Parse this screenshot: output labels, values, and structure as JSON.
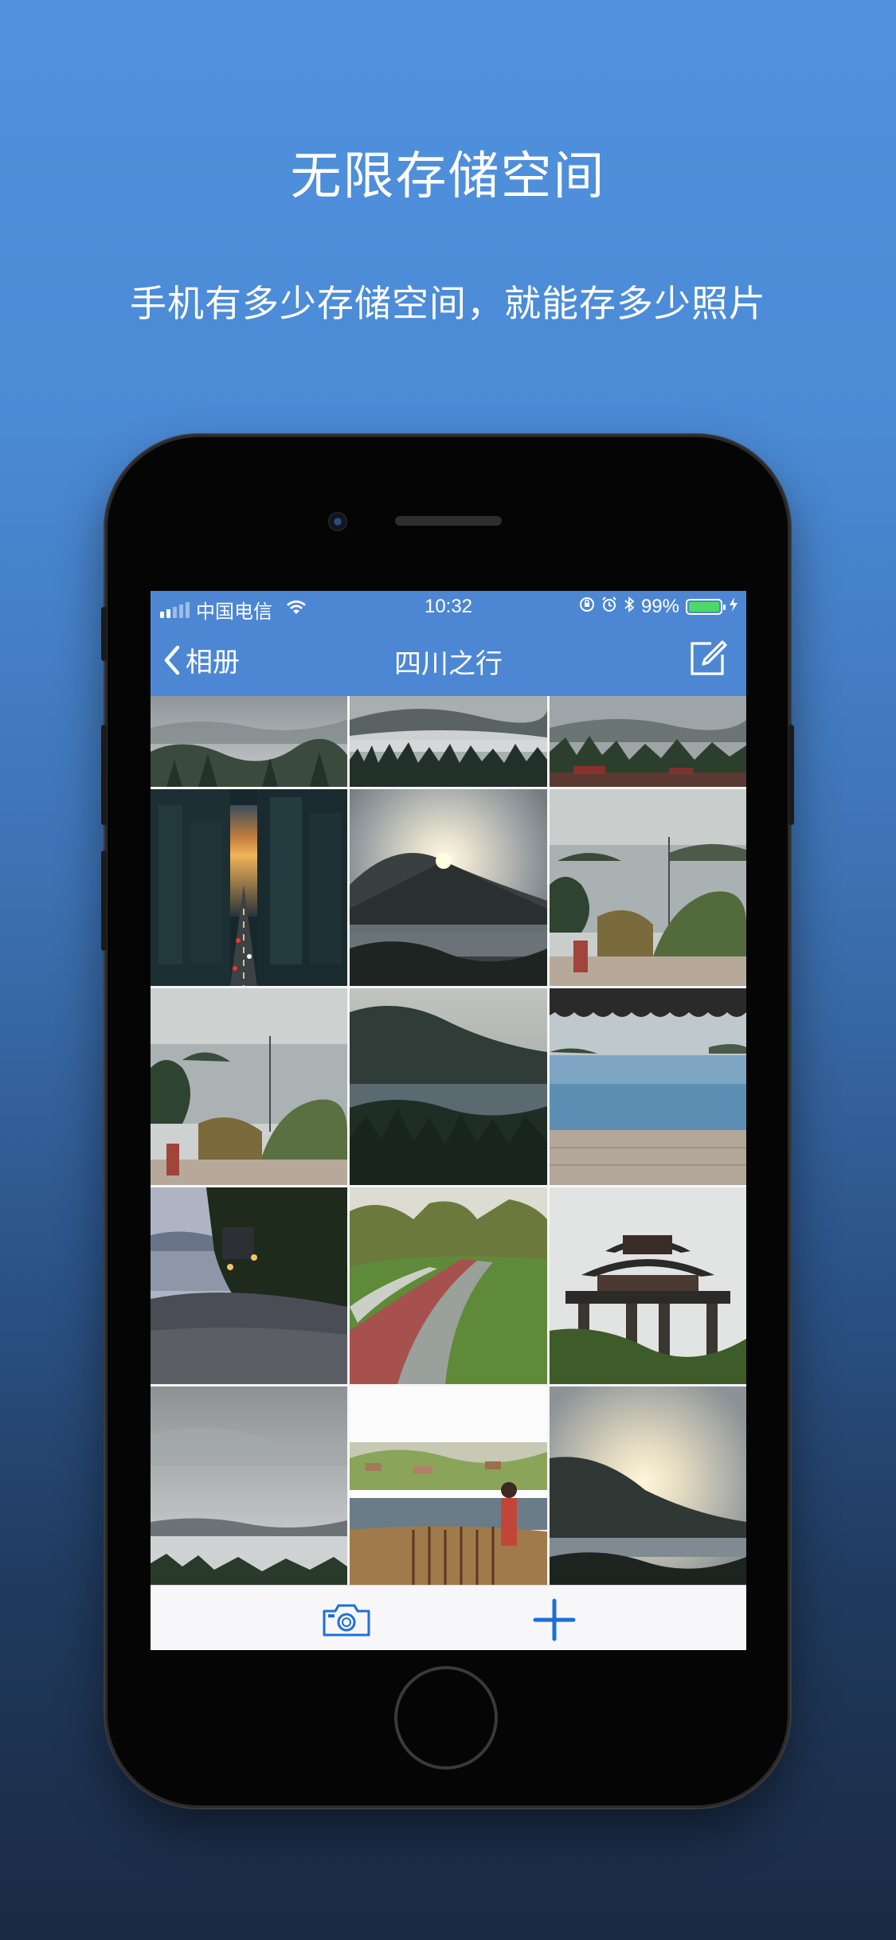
{
  "promo": {
    "title": "无限存储空间",
    "subtitle": "手机有多少存储空间，就能存多少照片"
  },
  "status_bar": {
    "carrier": "中国电信",
    "time": "10:32",
    "battery_percent": "99%",
    "battery_level": 0.99
  },
  "nav": {
    "back_label": "相册",
    "title": "四川之行"
  },
  "toolbar": {
    "camera_icon": "camera-icon",
    "add_icon": "plus-icon"
  },
  "colors": {
    "accent": "#1e6fd9",
    "nav_bar": "#4d87d3",
    "battery_fill": "#4cd964"
  },
  "photos": [
    "misty-lake-forest-1",
    "misty-mountain-forest",
    "misty-lake-garden",
    "city-street-sunset",
    "sunrise-over-mountain-lake",
    "lake-islands-balcony-1",
    "lake-islands-balcony-2",
    "mountain-lake-dusk",
    "infinity-pool-lake",
    "lakeside-dusk-shore",
    "park-path",
    "chinese-pavilion-gate",
    "cloudy-sky-lake",
    "village-field-child",
    "sunset-mountain-lake"
  ]
}
